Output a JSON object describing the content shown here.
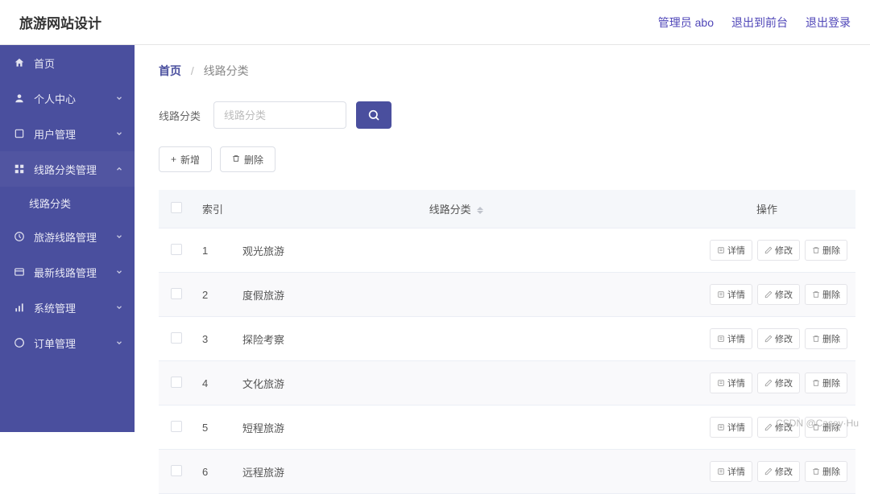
{
  "header": {
    "site_title": "旅游网站设计",
    "admin_label": "管理员 abo",
    "to_frontend": "退出到前台",
    "logout": "退出登录"
  },
  "sidebar": {
    "items": [
      {
        "label": "首页",
        "icon": "home-icon",
        "expandable": false
      },
      {
        "label": "个人中心",
        "icon": "user-icon",
        "expandable": true,
        "expanded": false
      },
      {
        "label": "用户管理",
        "icon": "users-icon",
        "expandable": true,
        "expanded": false
      },
      {
        "label": "线路分类管理",
        "icon": "category-icon",
        "expandable": true,
        "expanded": true,
        "children": [
          {
            "label": "线路分类"
          }
        ]
      },
      {
        "label": "旅游线路管理",
        "icon": "route-icon",
        "expandable": true,
        "expanded": false
      },
      {
        "label": "最新线路管理",
        "icon": "new-icon",
        "expandable": true,
        "expanded": false
      },
      {
        "label": "系统管理",
        "icon": "system-icon",
        "expandable": true,
        "expanded": false
      },
      {
        "label": "订单管理",
        "icon": "order-icon",
        "expandable": true,
        "expanded": false
      }
    ]
  },
  "breadcrumb": {
    "home": "首页",
    "current": "线路分类"
  },
  "filter": {
    "label": "线路分类",
    "placeholder": "线路分类"
  },
  "actions": {
    "add": "新增",
    "delete": "删除"
  },
  "table": {
    "columns": {
      "index": "索引",
      "category": "线路分类",
      "ops": "操作"
    },
    "op_labels": {
      "detail": "详情",
      "edit": "修改",
      "delete": "删除"
    },
    "rows": [
      {
        "idx": "1",
        "name": "观光旅游"
      },
      {
        "idx": "2",
        "name": "度假旅游"
      },
      {
        "idx": "3",
        "name": "探险考察"
      },
      {
        "idx": "4",
        "name": "文化旅游"
      },
      {
        "idx": "5",
        "name": "短程旅游"
      },
      {
        "idx": "6",
        "name": "远程旅游"
      }
    ]
  },
  "watermark": "CSDN @Casey·Hu"
}
